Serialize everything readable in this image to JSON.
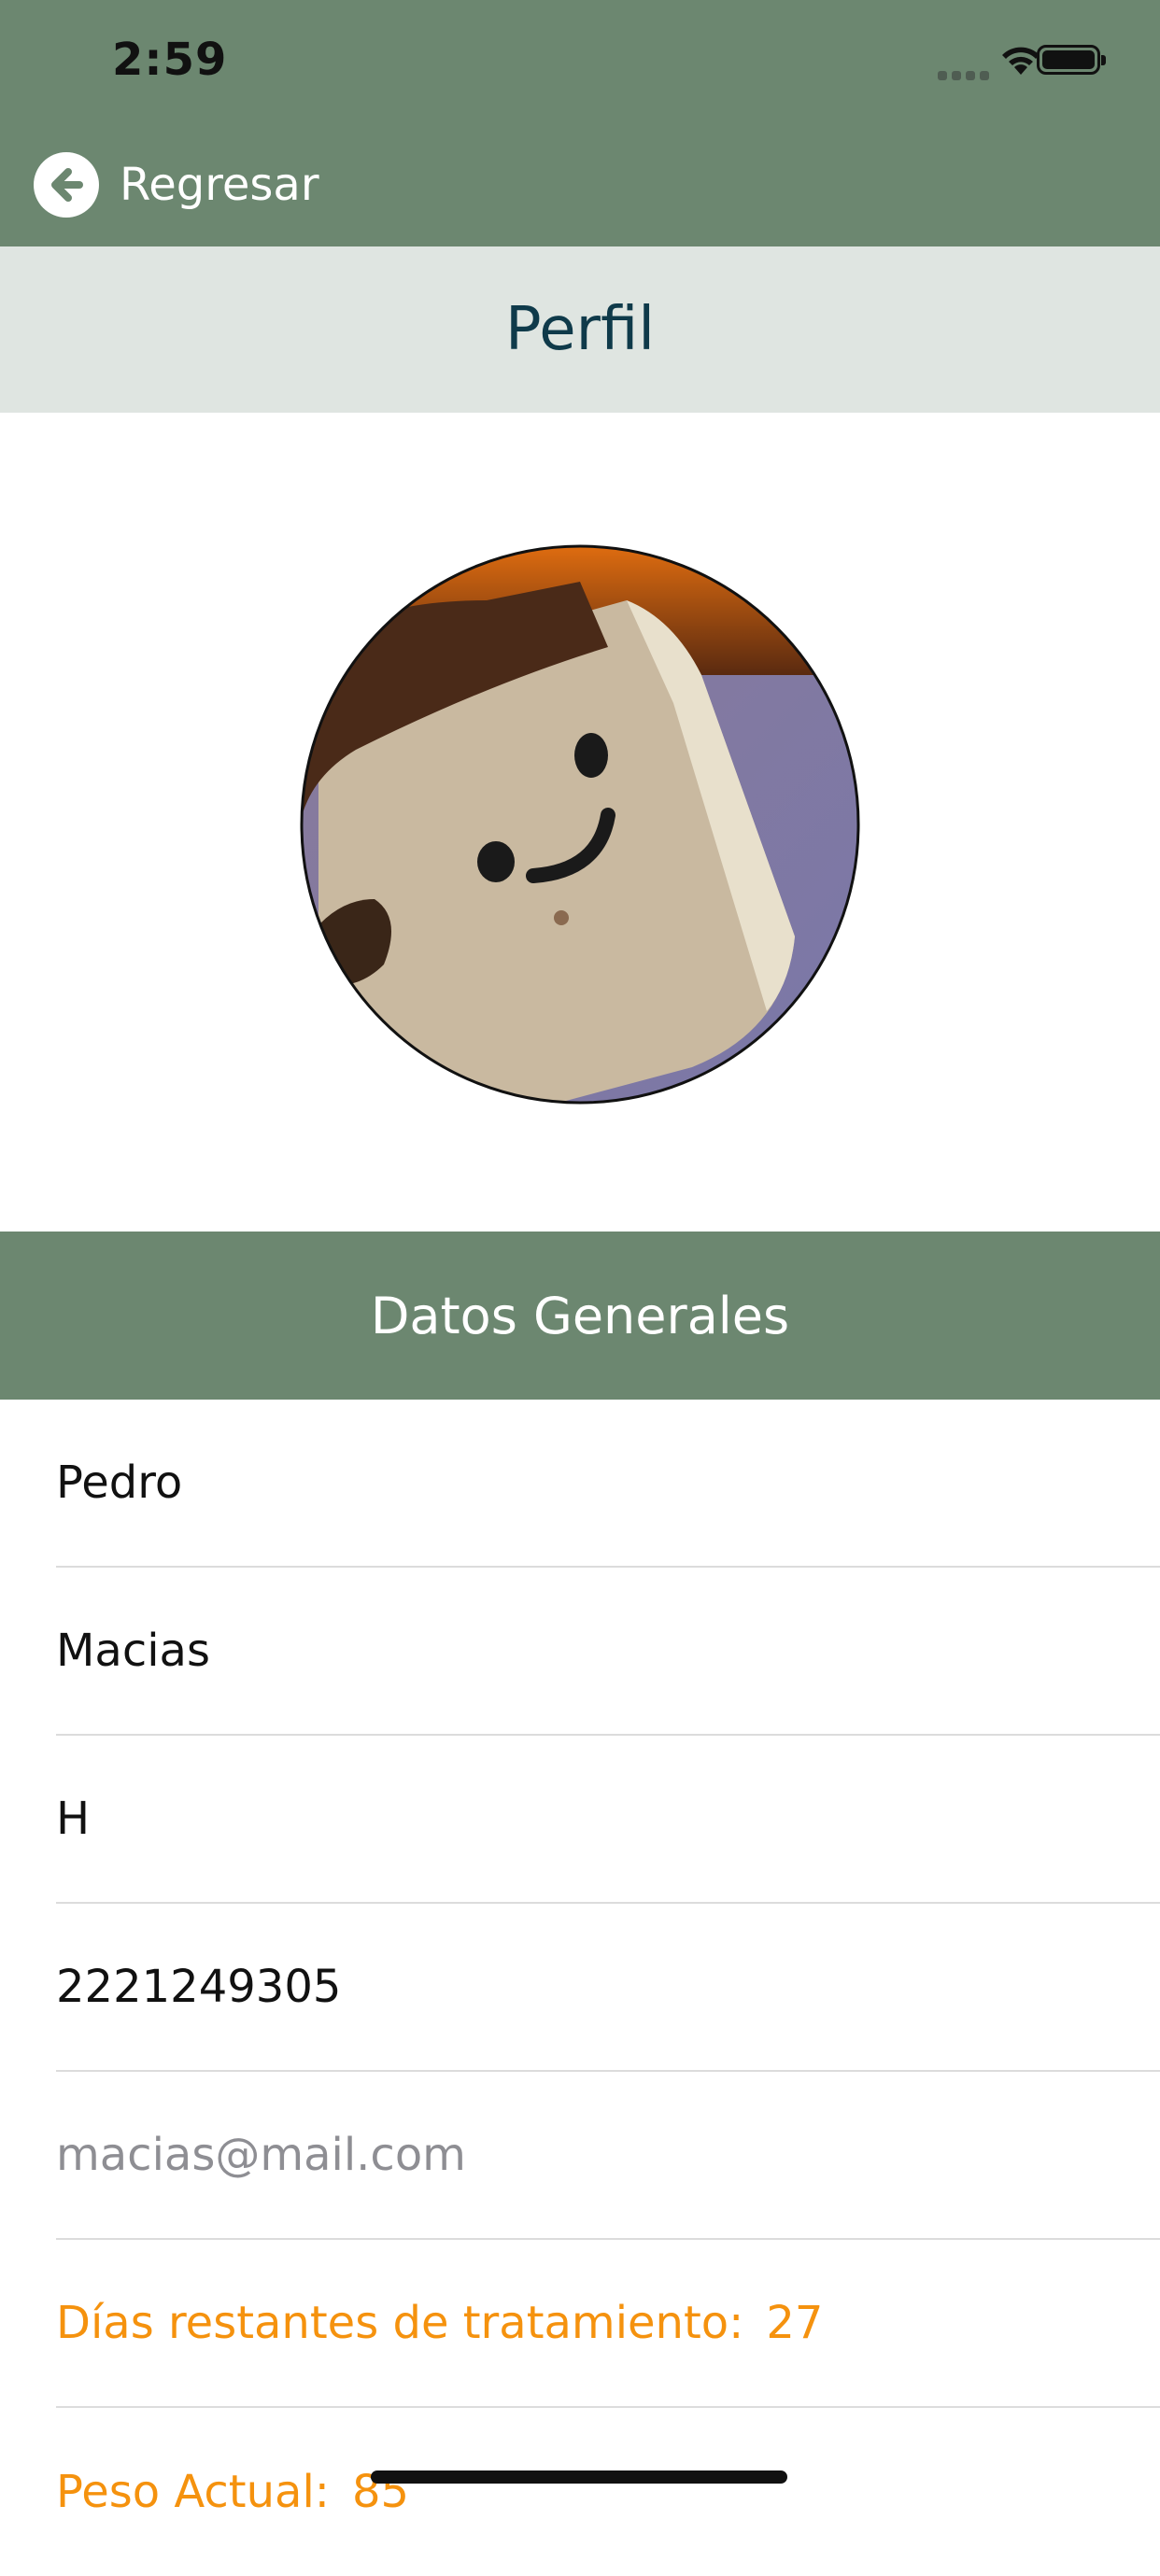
{
  "status_bar": {
    "time": "2:59"
  },
  "nav": {
    "back_label": "Regresar"
  },
  "page": {
    "title": "Perfil"
  },
  "profile": {
    "section_title": "Datos Generales"
  },
  "fields": {
    "first_name": "Pedro",
    "last_name": "Macias",
    "gender": "H",
    "phone": "2221249305",
    "email_placeholder": "macias@mail.com"
  },
  "info": {
    "days_label": "Días restantes de tratamiento:",
    "days_value": "27",
    "weight_label": "Peso Actual:",
    "weight_value": "85"
  },
  "colors": {
    "header_green": "#6c8770",
    "title_bar": "#dfe5e1",
    "title_text": "#0f3a4a",
    "accent_orange": "#f5920e"
  },
  "icons": {
    "back": "arrow-left-circle-icon",
    "wifi": "wifi-icon",
    "battery": "battery-icon",
    "signal": "signal-icon"
  }
}
